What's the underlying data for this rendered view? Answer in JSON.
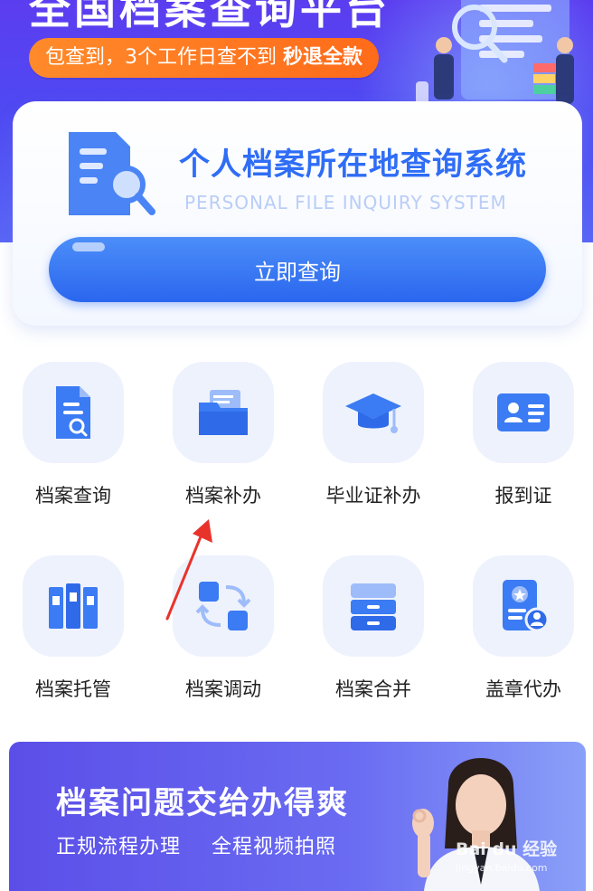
{
  "banner": {
    "title": "全国档案查询平台",
    "promo_prefix": "包查到，3个工作日查不到 ",
    "promo_highlight": "秒退全款"
  },
  "query_card": {
    "title": "个人档案所在地查询系统",
    "subtitle": "PERSONAL FILE INQUIRY SYSTEM",
    "button_label": "立即查询"
  },
  "services": [
    {
      "label": "档案查询",
      "icon": "file-search-icon"
    },
    {
      "label": "档案补办",
      "icon": "folder-icon"
    },
    {
      "label": "毕业证补办",
      "icon": "graduation-cap-icon"
    },
    {
      "label": "报到证",
      "icon": "id-card-icon"
    },
    {
      "label": "档案托管",
      "icon": "binders-icon"
    },
    {
      "label": "档案调动",
      "icon": "transfer-icon"
    },
    {
      "label": "档案合并",
      "icon": "cabinet-icon"
    },
    {
      "label": "盖章代办",
      "icon": "seal-document-icon"
    }
  ],
  "bottom_banner": {
    "title": "档案问题交给办得爽",
    "subtitle_1": "正规流程办理",
    "subtitle_2": "全程视频拍照"
  },
  "watermark": {
    "text": "Bai du 经验",
    "sub": "jingyan.baidu.com"
  },
  "colors": {
    "brand_blue": "#2f6df6",
    "banner_purple": "#5b3df0",
    "promo_orange": "#ff7a22",
    "tile_bg": "#eef2fd",
    "annotation_red": "#e8332a"
  }
}
